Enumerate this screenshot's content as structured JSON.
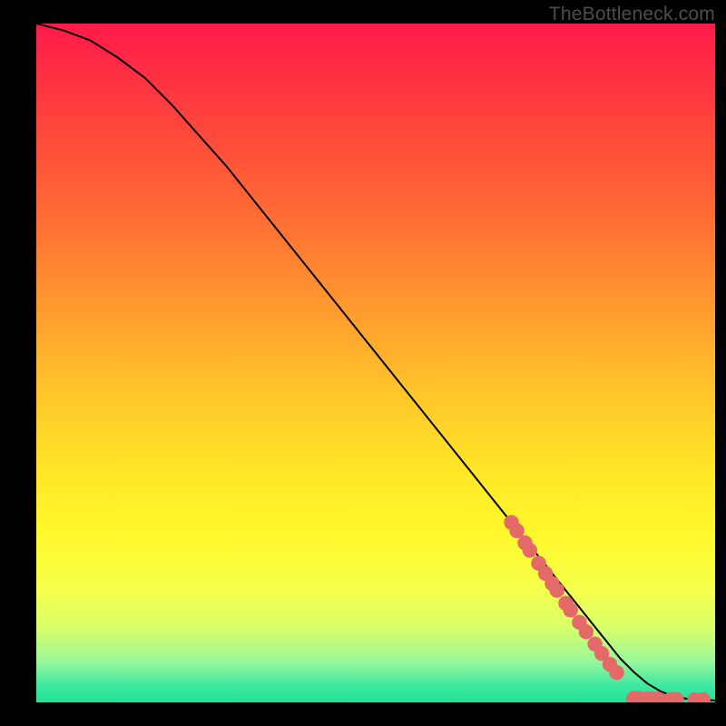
{
  "watermark": "TheBottleneck.com",
  "chart_data": {
    "type": "line",
    "title": "",
    "xlabel": "",
    "ylabel": "",
    "xlim": [
      0,
      100
    ],
    "ylim": [
      0,
      100
    ],
    "grid": false,
    "axis_visible": false,
    "series": [
      {
        "name": "curve",
        "style": "line",
        "color": "#000000",
        "x": [
          0,
          4,
          8,
          12,
          16,
          20,
          24,
          28,
          32,
          36,
          40,
          44,
          48,
          52,
          56,
          60,
          64,
          68,
          72,
          76,
          80,
          82,
          84,
          86,
          88,
          90,
          92,
          94,
          96,
          98,
          100
        ],
        "y": [
          100,
          99,
          97.5,
          95,
          92,
          88,
          83.5,
          79,
          74,
          69,
          64,
          59,
          54,
          49,
          44,
          39,
          34,
          29,
          24,
          19,
          14,
          11.5,
          9,
          6.5,
          4.5,
          2.8,
          1.6,
          0.9,
          0.5,
          0.35,
          0.3
        ]
      },
      {
        "name": "dots",
        "style": "scatter",
        "color": "#e46a6a",
        "radius_plot_units": 1.1,
        "points_xy": [
          [
            70,
            26.5
          ],
          [
            70.8,
            25.3
          ],
          [
            72,
            23.5
          ],
          [
            72.7,
            22.4
          ],
          [
            74,
            20.5
          ],
          [
            75,
            19
          ],
          [
            76,
            17.5
          ],
          [
            76.7,
            16.5
          ],
          [
            78,
            14.6
          ],
          [
            78.7,
            13.6
          ],
          [
            80,
            11.8
          ],
          [
            81,
            10.4
          ],
          [
            82.3,
            8.6
          ],
          [
            83.3,
            7.2
          ],
          [
            84.5,
            5.6
          ],
          [
            85.5,
            4.4
          ],
          [
            88,
            0.6
          ],
          [
            88.8,
            0.6
          ],
          [
            90,
            0.55
          ],
          [
            90.8,
            0.5
          ],
          [
            91.6,
            0.5
          ],
          [
            93.5,
            0.45
          ],
          [
            94.3,
            0.45
          ],
          [
            97,
            0.4
          ],
          [
            98.2,
            0.4
          ]
        ]
      }
    ]
  }
}
